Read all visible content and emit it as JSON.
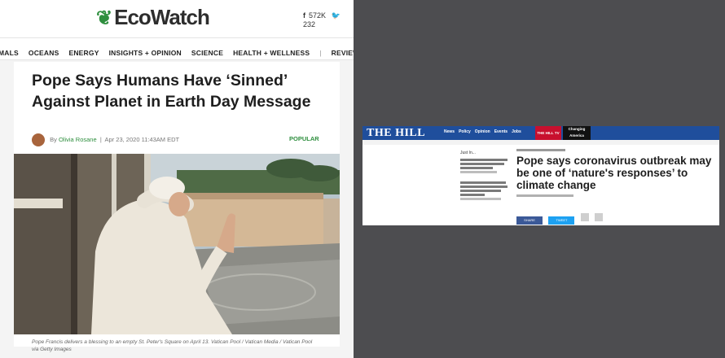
{
  "ecowatch": {
    "logo": "EcoWatch",
    "social": {
      "facebook": "572K",
      "twitter": "232"
    },
    "nav": [
      "MALS",
      "OCEANS",
      "ENERGY",
      "INSIGHTS + OPINION",
      "SCIENCE",
      "HEALTH + WELLNESS",
      "|",
      "REVIEWS"
    ],
    "article": {
      "headline": "Pope Says Humans Have ‘Sinned’ Against Planet in Earth Day Message",
      "by": "By",
      "author": "Olivia Rosane",
      "separator": "|",
      "date": "Apr 23, 2020 11:43AM EDT",
      "tag": "POPULAR",
      "caption": "Pope Francis delivers a blessing to an empty St. Peter's Square on April 13. Vatican Pool / Vatican Media / Vatican Pool via Getty Images"
    }
  },
  "thehill": {
    "logo": "THE HILL",
    "nav": [
      "News",
      "Policy",
      "Opinion",
      "Events",
      "Jobs"
    ],
    "tv": "THE HILL TV",
    "changing": [
      "Changing",
      "America"
    ],
    "side_label": "Just In...",
    "headline": "Pope says coronavirus outbreak may be one of ‘nature's responses’ to climate change",
    "share": [
      "SHARE",
      "TWEET"
    ]
  }
}
